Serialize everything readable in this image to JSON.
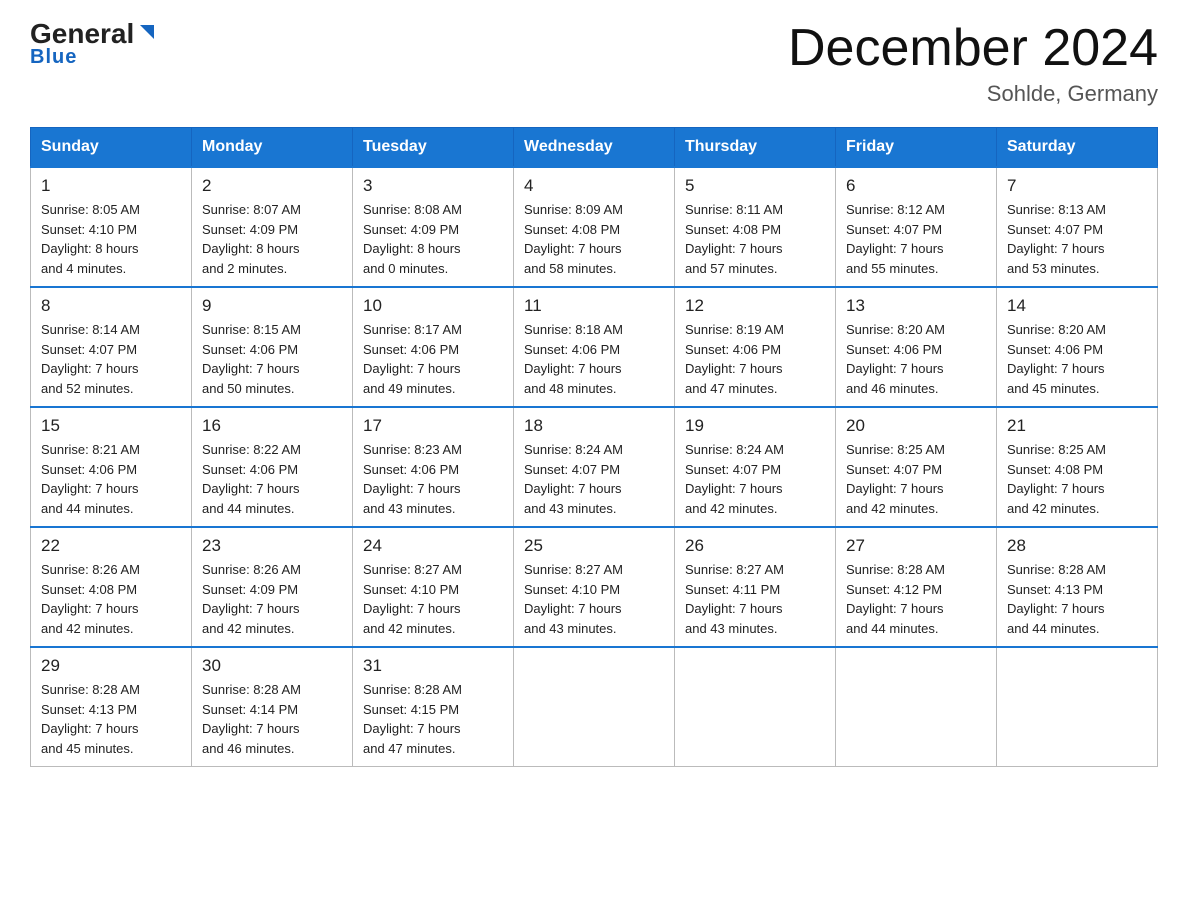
{
  "logo": {
    "text1": "General",
    "text2": "Blue"
  },
  "title": "December 2024",
  "subtitle": "Sohlde, Germany",
  "days_of_week": [
    "Sunday",
    "Monday",
    "Tuesday",
    "Wednesday",
    "Thursday",
    "Friday",
    "Saturday"
  ],
  "weeks": [
    [
      {
        "day": "1",
        "sunrise": "8:05 AM",
        "sunset": "4:10 PM",
        "daylight": "8 hours and 4 minutes."
      },
      {
        "day": "2",
        "sunrise": "8:07 AM",
        "sunset": "4:09 PM",
        "daylight": "8 hours and 2 minutes."
      },
      {
        "day": "3",
        "sunrise": "8:08 AM",
        "sunset": "4:09 PM",
        "daylight": "8 hours and 0 minutes."
      },
      {
        "day": "4",
        "sunrise": "8:09 AM",
        "sunset": "4:08 PM",
        "daylight": "7 hours and 58 minutes."
      },
      {
        "day": "5",
        "sunrise": "8:11 AM",
        "sunset": "4:08 PM",
        "daylight": "7 hours and 57 minutes."
      },
      {
        "day": "6",
        "sunrise": "8:12 AM",
        "sunset": "4:07 PM",
        "daylight": "7 hours and 55 minutes."
      },
      {
        "day": "7",
        "sunrise": "8:13 AM",
        "sunset": "4:07 PM",
        "daylight": "7 hours and 53 minutes."
      }
    ],
    [
      {
        "day": "8",
        "sunrise": "8:14 AM",
        "sunset": "4:07 PM",
        "daylight": "7 hours and 52 minutes."
      },
      {
        "day": "9",
        "sunrise": "8:15 AM",
        "sunset": "4:06 PM",
        "daylight": "7 hours and 50 minutes."
      },
      {
        "day": "10",
        "sunrise": "8:17 AM",
        "sunset": "4:06 PM",
        "daylight": "7 hours and 49 minutes."
      },
      {
        "day": "11",
        "sunrise": "8:18 AM",
        "sunset": "4:06 PM",
        "daylight": "7 hours and 48 minutes."
      },
      {
        "day": "12",
        "sunrise": "8:19 AM",
        "sunset": "4:06 PM",
        "daylight": "7 hours and 47 minutes."
      },
      {
        "day": "13",
        "sunrise": "8:20 AM",
        "sunset": "4:06 PM",
        "daylight": "7 hours and 46 minutes."
      },
      {
        "day": "14",
        "sunrise": "8:20 AM",
        "sunset": "4:06 PM",
        "daylight": "7 hours and 45 minutes."
      }
    ],
    [
      {
        "day": "15",
        "sunrise": "8:21 AM",
        "sunset": "4:06 PM",
        "daylight": "7 hours and 44 minutes."
      },
      {
        "day": "16",
        "sunrise": "8:22 AM",
        "sunset": "4:06 PM",
        "daylight": "7 hours and 44 minutes."
      },
      {
        "day": "17",
        "sunrise": "8:23 AM",
        "sunset": "4:06 PM",
        "daylight": "7 hours and 43 minutes."
      },
      {
        "day": "18",
        "sunrise": "8:24 AM",
        "sunset": "4:07 PM",
        "daylight": "7 hours and 43 minutes."
      },
      {
        "day": "19",
        "sunrise": "8:24 AM",
        "sunset": "4:07 PM",
        "daylight": "7 hours and 42 minutes."
      },
      {
        "day": "20",
        "sunrise": "8:25 AM",
        "sunset": "4:07 PM",
        "daylight": "7 hours and 42 minutes."
      },
      {
        "day": "21",
        "sunrise": "8:25 AM",
        "sunset": "4:08 PM",
        "daylight": "7 hours and 42 minutes."
      }
    ],
    [
      {
        "day": "22",
        "sunrise": "8:26 AM",
        "sunset": "4:08 PM",
        "daylight": "7 hours and 42 minutes."
      },
      {
        "day": "23",
        "sunrise": "8:26 AM",
        "sunset": "4:09 PM",
        "daylight": "7 hours and 42 minutes."
      },
      {
        "day": "24",
        "sunrise": "8:27 AM",
        "sunset": "4:10 PM",
        "daylight": "7 hours and 42 minutes."
      },
      {
        "day": "25",
        "sunrise": "8:27 AM",
        "sunset": "4:10 PM",
        "daylight": "7 hours and 43 minutes."
      },
      {
        "day": "26",
        "sunrise": "8:27 AM",
        "sunset": "4:11 PM",
        "daylight": "7 hours and 43 minutes."
      },
      {
        "day": "27",
        "sunrise": "8:28 AM",
        "sunset": "4:12 PM",
        "daylight": "7 hours and 44 minutes."
      },
      {
        "day": "28",
        "sunrise": "8:28 AM",
        "sunset": "4:13 PM",
        "daylight": "7 hours and 44 minutes."
      }
    ],
    [
      {
        "day": "29",
        "sunrise": "8:28 AM",
        "sunset": "4:13 PM",
        "daylight": "7 hours and 45 minutes."
      },
      {
        "day": "30",
        "sunrise": "8:28 AM",
        "sunset": "4:14 PM",
        "daylight": "7 hours and 46 minutes."
      },
      {
        "day": "31",
        "sunrise": "8:28 AM",
        "sunset": "4:15 PM",
        "daylight": "7 hours and 47 minutes."
      },
      null,
      null,
      null,
      null
    ]
  ],
  "labels": {
    "sunrise": "Sunrise:",
    "sunset": "Sunset:",
    "daylight": "Daylight:"
  }
}
